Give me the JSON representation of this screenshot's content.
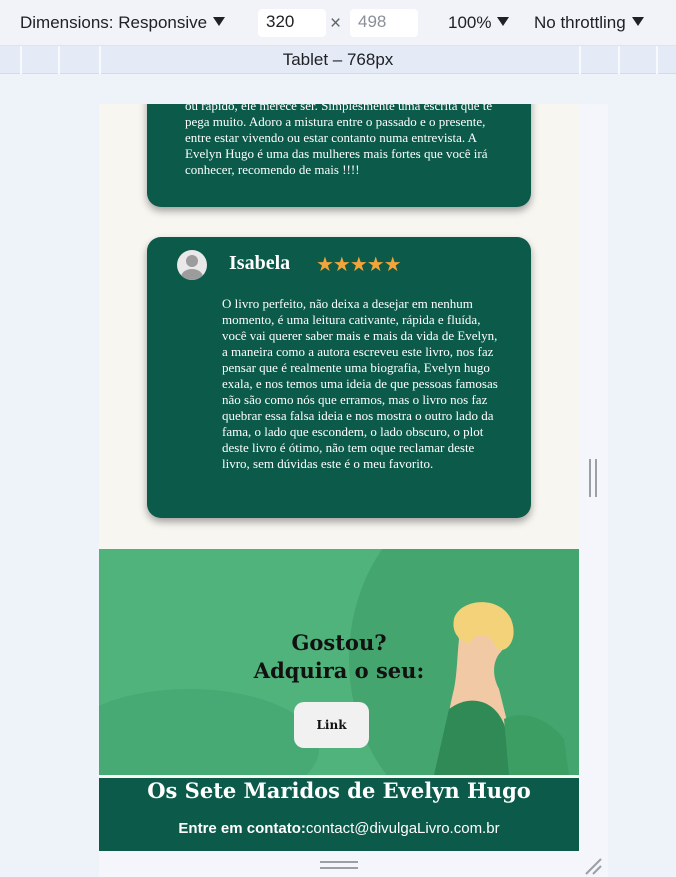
{
  "devtools": {
    "dimensions_label": "Dimensions: Responsive",
    "width": "320",
    "height": "498",
    "times": "×",
    "zoom": "100%",
    "throttling": "No throttling",
    "media_label": "Tablet – 768px"
  },
  "reviews": [
    {
      "text": "ou rápido, ele merece ser. Simplesmente uma escrita que te pega muito. Adoro a mistura entre o passado e o presente, entre estar vivendo ou estar contanto numa entrevista. A Evelyn Hugo é uma das mulheres mais fortes que você irá conhecer, recomendo de mais !!!!"
    },
    {
      "name": "Isabela",
      "stars": "★★★★★",
      "rating": 5,
      "text": "O livro perfeito, não deixa a desejar em nenhum momento, é uma leitura cativante, rápida e fluída, você vai querer saber mais e mais da vida de Evelyn, a maneira como a autora escreveu este livro, nos faz pensar que é realmente uma biografia, Evelyn hugo exala, e nos temos uma ideia de que pessoas famosas não são como nós que erramos, mas o livro nos faz quebrar essa falsa ideia e nos mostra o outro lado da fama, o lado que escondem, o lado obscuro, o plot deste livro é ótimo, não tem oque reclamar deste livro, sem dúvidas este é o meu favorito."
    }
  ],
  "hero": {
    "line1": "Gostou?",
    "line2": "Adquira o seu:",
    "button": "Link"
  },
  "footer": {
    "title": "Os Sete Maridos de Evelyn Hugo",
    "contact_label": "Entre em contato:",
    "contact_email": "contact@divulgaLivro.com.br"
  },
  "colors": {
    "card": "#0b5a4a",
    "hero": "#4fb37b",
    "stars": "#f3a53a"
  }
}
